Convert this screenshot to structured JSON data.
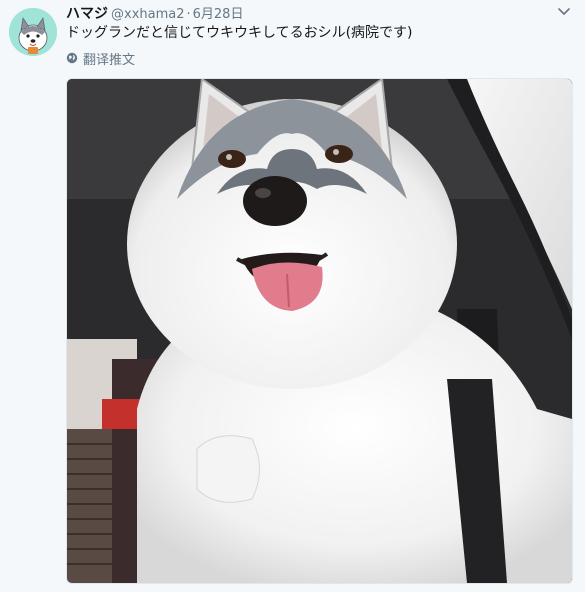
{
  "tweet": {
    "author_name": "ハマジ",
    "handle": "@xxhama2",
    "separator": "·",
    "date": "6月28日",
    "text": "ドッグランだと信じてウキウキしてるおシル(病院です)",
    "translate_label": "翻译推文",
    "icons": {
      "menu": "chevron-down-icon",
      "translate": "globe-icon"
    },
    "media": {
      "subject": "husky-photo"
    }
  },
  "colors": {
    "name": "#14171a",
    "secondary": "#657786",
    "avatar_bg": "#9fe3d9",
    "background": "#f5f8fa"
  }
}
